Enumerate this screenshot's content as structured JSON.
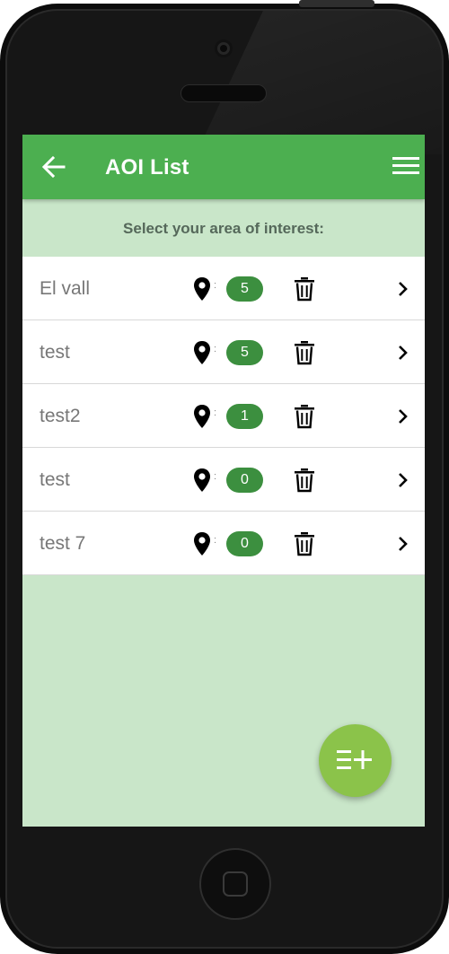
{
  "app_bar": {
    "title": "AOI List",
    "back_icon": "arrow-left-icon",
    "menu_icon": "hamburger-menu-icon",
    "background_color": "#4caf50"
  },
  "instruction": "Select your area of interest:",
  "items": [
    {
      "name": "El vall",
      "count": "5"
    },
    {
      "name": "test",
      "count": "5"
    },
    {
      "name": "test2",
      "count": "1"
    },
    {
      "name": "test",
      "count": "0"
    },
    {
      "name": "test 7",
      "count": "0"
    }
  ],
  "row_separator": ":",
  "icons": {
    "location": "map-pin-icon",
    "delete": "trash-icon",
    "open": "chevron-right-icon",
    "add_list": "playlist-add-icon"
  },
  "colors": {
    "screen_background": "#c9e6c9",
    "badge": "#3c8f3f",
    "fab": "#8bc34a"
  }
}
